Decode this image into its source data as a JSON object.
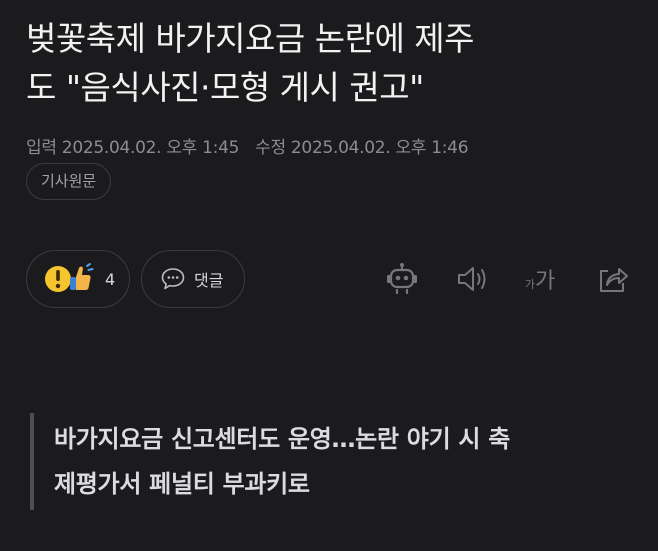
{
  "article": {
    "headline_line1": "벚꽃축제 바가지요금 논란에 제주",
    "headline_line2": "도 \"음식사진·모형 게시 권고\"",
    "input_label": "입력",
    "input_time": "2025.04.02. 오후 1:45",
    "modified_label": "수정",
    "modified_time": "2025.04.02. 오후 1:46",
    "source_button": "기사원문",
    "subheadline_line1": "바가지요금 신고센터도 운영…논란 야기 시 축",
    "subheadline_line2": "제평가서 페널티 부과키로"
  },
  "actions": {
    "reaction_icon": "reaction-emoji-icon",
    "reaction_count": "4",
    "comment_icon": "speech-bubble-icon",
    "comment_label": "댓글",
    "tools": [
      {
        "icon": "robot-summary-icon"
      },
      {
        "icon": "speaker-icon"
      },
      {
        "icon": "font-size-icon",
        "small": "가",
        "big": "가"
      },
      {
        "icon": "share-icon"
      }
    ]
  },
  "colors": {
    "background": "#1b1b1d",
    "headline": "#f2f2f2",
    "meta": "#8d8d8f",
    "border": "#3c3c3f",
    "icon": "#77777a",
    "quote_bar": "#4e4e52"
  }
}
